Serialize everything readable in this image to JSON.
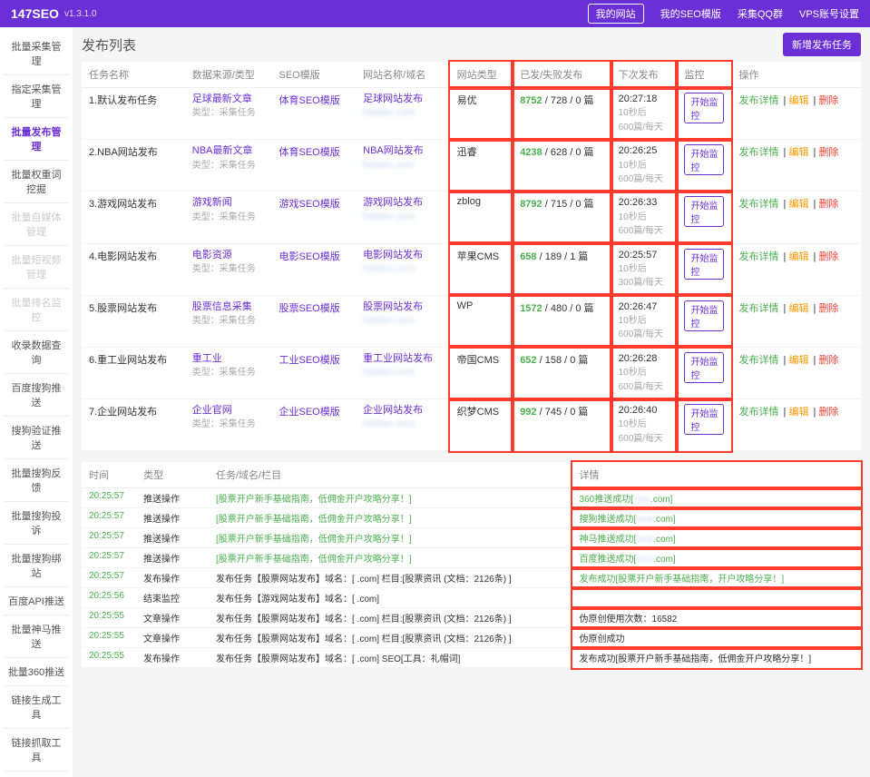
{
  "topbar": {
    "brand": "147SEO",
    "version": "v1.3.1.0",
    "nav": [
      "我的网站",
      "我的SEO模版",
      "采集QQ群",
      "VPS账号设置"
    ],
    "active": 0
  },
  "sidebar": {
    "items": [
      {
        "label": "批量采集管理",
        "state": ""
      },
      {
        "label": "指定采集管理",
        "state": ""
      },
      {
        "label": "批量发布管理",
        "state": "active"
      },
      {
        "label": "批量权重词挖掘",
        "state": ""
      },
      {
        "label": "批量自媒体管理",
        "state": "disabled"
      },
      {
        "label": "批量短视频管理",
        "state": "disabled"
      },
      {
        "label": "批量排名监控",
        "state": "disabled"
      },
      {
        "label": "收录数据查询",
        "state": ""
      },
      {
        "label": "百度搜狗推送",
        "state": ""
      },
      {
        "label": "搜狗验证推送",
        "state": ""
      },
      {
        "label": "批量搜狗反馈",
        "state": ""
      },
      {
        "label": "批量搜狗投诉",
        "state": ""
      },
      {
        "label": "批量搜狗绑站",
        "state": ""
      },
      {
        "label": "百度API推送",
        "state": ""
      },
      {
        "label": "批量神马推送",
        "state": ""
      },
      {
        "label": "批量360推送",
        "state": ""
      },
      {
        "label": "链接生成工具",
        "state": ""
      },
      {
        "label": "链接抓取工具",
        "state": ""
      }
    ]
  },
  "panel": {
    "title": "发布列表",
    "addBtn": "新增发布任务"
  },
  "table1": {
    "headers": [
      "任务名称",
      "数据来源/类型",
      "SEO模版",
      "网站名称/域名",
      "网站类型",
      "已发/失败发布",
      "下次发布",
      "监控",
      "操作"
    ],
    "rows": [
      {
        "idx": "1",
        "name": "默认发布任务",
        "src": "足球最新文章",
        "srcSub": "类型：采集任务",
        "tpl": "体育SEO模版",
        "site": "足球网站发布",
        "siteSub": ".com",
        "stype": "易优",
        "p1": "8752",
        "p2": "728",
        "p3": "0",
        "next": "20:27:18",
        "nextSub": "10秒后\n600篇/每天",
        "mon": "开始监控"
      },
      {
        "idx": "2",
        "name": "NBA网站发布",
        "src": "NBA最新文章",
        "srcSub": "类型：采集任务",
        "tpl": "体育SEO模版",
        "site": "NBA网站发布",
        "siteSub": ".com",
        "stype": "迅睿",
        "p1": "4238",
        "p2": "628",
        "p3": "0",
        "next": "20:26:25",
        "nextSub": "10秒后\n600篇/每天",
        "mon": "开始监控"
      },
      {
        "idx": "3",
        "name": "游戏网站发布",
        "src": "游戏新闻",
        "srcSub": "类型：采集任务",
        "tpl": "游戏SEO模版",
        "site": "游戏网站发布",
        "siteSub": ".com",
        "stype": "zblog",
        "p1": "8792",
        "p2": "715",
        "p3": "0",
        "next": "20:26:33",
        "nextSub": "10秒后\n600篇/每天",
        "mon": "开始监控"
      },
      {
        "idx": "4",
        "name": "电影网站发布",
        "src": "电影资源",
        "srcSub": "类型：采集任务",
        "tpl": "电影SEO模版",
        "site": "电影网站发布",
        "siteSub": ".com",
        "stype": "苹果CMS",
        "p1": "658",
        "p2": "189",
        "p3": "1",
        "next": "20:25:57",
        "nextSub": "10秒后\n300篇/每天",
        "mon": "开始监控"
      },
      {
        "idx": "5",
        "name": "股票网站发布",
        "src": "股票信息采集",
        "srcSub": "类型：采集任务",
        "tpl": "股票SEO模版",
        "site": "股票网站发布",
        "siteSub": ".com",
        "stype": "WP",
        "p1": "1572",
        "p2": "480",
        "p3": "0",
        "next": "20:26:47",
        "nextSub": "10秒后\n600篇/每天",
        "mon": "开始监控"
      },
      {
        "idx": "6",
        "name": "重工业网站发布",
        "src": "重工业",
        "srcSub": "类型：采集任务",
        "tpl": "工业SEO模版",
        "site": "重工业网站发布",
        "siteSub": ".com",
        "stype": "帝国CMS",
        "p1": "652",
        "p2": "158",
        "p3": "0",
        "next": "20:26:28",
        "nextSub": "10秒后\n600篇/每天",
        "mon": "开始监控"
      },
      {
        "idx": "7",
        "name": "企业网站发布",
        "src": "企业官网",
        "srcSub": "类型：采集任务",
        "tpl": "企业SEO模版",
        "site": "企业网站发布",
        "siteSub": ".com",
        "stype": "织梦CMS",
        "p1": "992",
        "p2": "745",
        "p3": "0",
        "next": "20:26:40",
        "nextSub": "10秒后\n600篇/每天",
        "mon": "开始监控"
      }
    ],
    "pubUnit": "篇",
    "ops": {
      "detail": "发布详情",
      "edit": "编辑",
      "del": "删除"
    }
  },
  "log": {
    "headers": [
      "时间",
      "类型",
      "任务/域名/栏目",
      "",
      "详情"
    ],
    "rows": [
      {
        "t": "20:25:57",
        "ty": "推送操作",
        "task": "[股票开户新手基础指南，低佣金开户攻略分享！]",
        "tc": "green",
        "d": "360推送成功[",
        "ds": ".com]",
        "dc": "green"
      },
      {
        "t": "20:25:57",
        "ty": "推送操作",
        "task": "[股票开户新手基础指南，低佣金开户攻略分享！]",
        "tc": "green",
        "d": "搜狗推送成功[",
        "ds": ".com]",
        "dc": "green"
      },
      {
        "t": "20:25:57",
        "ty": "推送操作",
        "task": "[股票开户新手基础指南，低佣金开户攻略分享！]",
        "tc": "green",
        "d": "神马推送成功[",
        "ds": ".com]",
        "dc": "green"
      },
      {
        "t": "20:25:57",
        "ty": "推送操作",
        "task": "[股票开户新手基础指南，低佣金开户攻略分享！]",
        "tc": "green",
        "d": "百度推送成功[",
        "ds": ".com]",
        "dc": "green"
      },
      {
        "t": "20:25:57",
        "ty": "发布操作",
        "task": "发布任务【股票网站发布】域名：[             .com] 栏目:[股票资讯 (文档：2126条) ]",
        "tc": "",
        "d": "发布成功[股票开户新手基础指南，开户攻略分享！]",
        "ds": "",
        "dc": "green"
      },
      {
        "t": "20:25:56",
        "ty": "结束监控",
        "task": "发布任务【游戏网站发布】域名：[             .com]",
        "tc": "",
        "d": "",
        "ds": "",
        "dc": ""
      },
      {
        "t": "20:25:55",
        "ty": "文章操作",
        "task": "发布任务【股票网站发布】域名：[             .com] 栏目:[股票资讯 (文档：2126条) ]",
        "tc": "",
        "d": "伪原创使用次数：16582",
        "ds": "",
        "dc": ""
      },
      {
        "t": "20:25:55",
        "ty": "文章操作",
        "task": "发布任务【股票网站发布】域名：[             .com] 栏目:[股票资讯 (文档：2126条) ]",
        "tc": "",
        "d": "伪原创成功",
        "ds": "",
        "dc": ""
      },
      {
        "t": "20:25:55",
        "ty": "发布操作",
        "task": "发布任务【股票网站发布】域名：[             .com] SEO[工具：礼帽词]",
        "tc": "",
        "d": "发布成功[股票开户新手基础指南，低佣金开户攻略分享！]",
        "ds": "",
        "dc": ""
      }
    ]
  }
}
